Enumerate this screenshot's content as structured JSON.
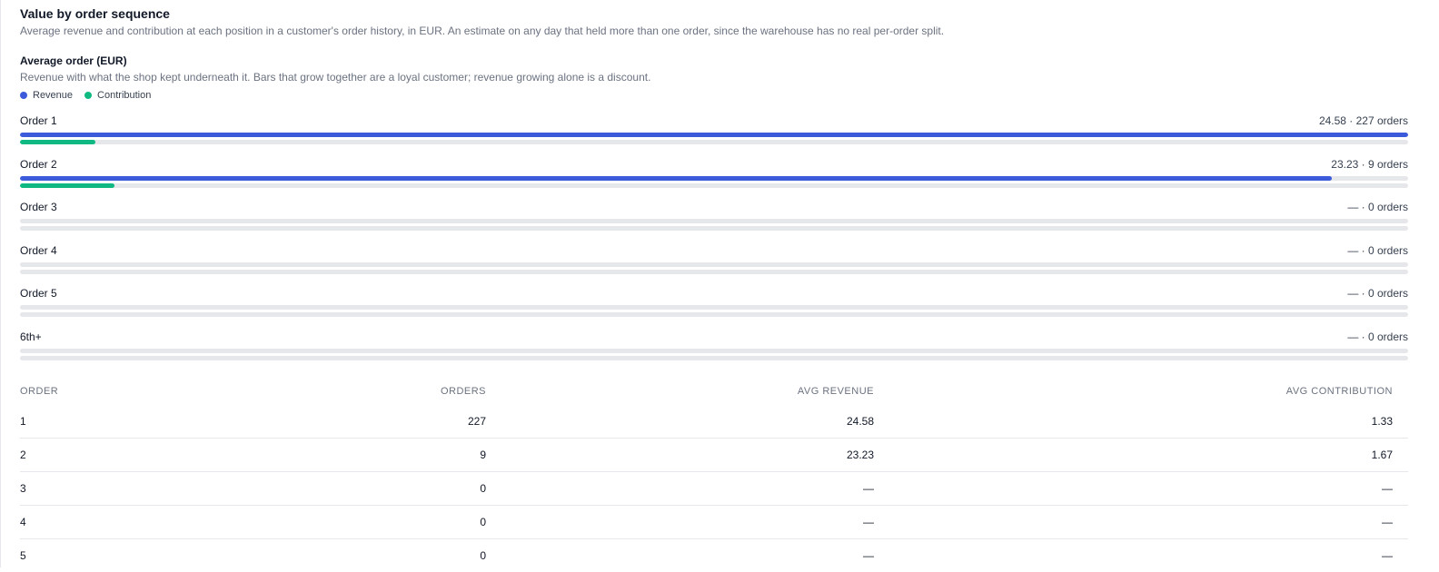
{
  "section": {
    "title": "Value by order sequence",
    "description": "Average revenue and contribution at each position in a customer's order history, in EUR. An estimate on any day that held more than one order, since the warehouse has no real per-order split."
  },
  "colors": {
    "revenue": "#3b5bdb",
    "contribution": "#10b981",
    "track": "#e5e7eb"
  },
  "chart_data": {
    "type": "bar",
    "orientation": "horizontal",
    "title": "Average order (EUR)",
    "subtitle": "Revenue with what the shop kept underneath it. Bars that grow together are a loyal customer; revenue growing alone is a discount.",
    "categories": [
      "Order 1",
      "Order 2",
      "Order 3",
      "Order 4",
      "Order 5",
      "6th+"
    ],
    "series": [
      {
        "name": "Revenue",
        "values": [
          24.58,
          23.23,
          null,
          null,
          null,
          null
        ]
      },
      {
        "name": "Contribution",
        "values": [
          1.33,
          1.67,
          null,
          null,
          null,
          null
        ]
      }
    ],
    "value_labels": [
      "24.58 · 227 orders",
      "23.23 · 9 orders",
      "— · 0 orders",
      "— · 0 orders",
      "— · 0 orders",
      "— · 0 orders"
    ],
    "xlim": [
      0,
      24.58
    ],
    "legend": "top-left"
  },
  "table": {
    "headers": [
      "ORDER",
      "ORDERS",
      "AVG REVENUE",
      "AVG CONTRIBUTION"
    ],
    "rows": [
      [
        "1",
        "227",
        "24.58",
        "1.33"
      ],
      [
        "2",
        "9",
        "23.23",
        "1.67"
      ],
      [
        "3",
        "0",
        "—",
        "—"
      ],
      [
        "4",
        "0",
        "—",
        "—"
      ],
      [
        "5",
        "0",
        "—",
        "—"
      ]
    ]
  }
}
